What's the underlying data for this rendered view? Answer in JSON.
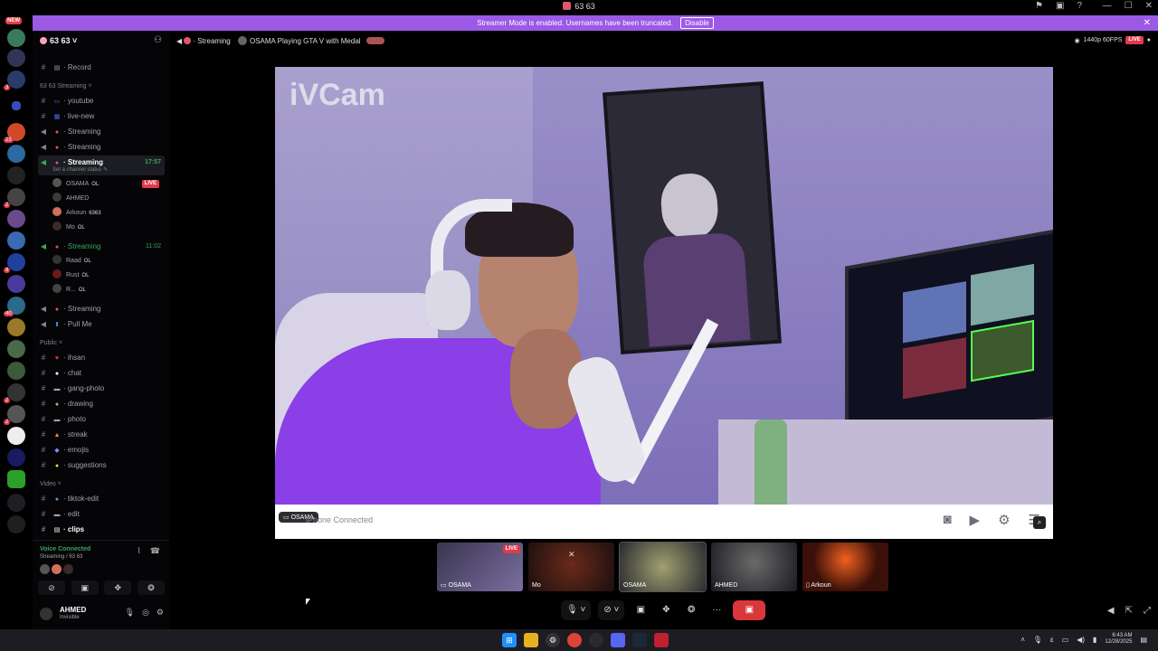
{
  "window": {
    "title": "63 63"
  },
  "banner": {
    "text": "Streamer Mode is enabled. Usernames have been truncated.",
    "disable_label": "Disable"
  },
  "guild_rail": {
    "new_badge": "NEW"
  },
  "sidebar": {
    "server_name": "63 63",
    "top_items": [
      "Record"
    ],
    "streaming_category": "63 63 Streaming",
    "channels": [
      {
        "label": "youtube"
      },
      {
        "label": "live-new"
      },
      {
        "label": "Streaming"
      },
      {
        "label": "Streaming"
      }
    ],
    "active_channel": {
      "label": "Streaming",
      "time": "17:57",
      "status": "Set a channel status"
    },
    "active_members": [
      {
        "name": "OSAMA",
        "tag": "OL",
        "live": "LIVE"
      },
      {
        "name": "AHMED",
        "tag": ""
      },
      {
        "name": "Arkoun",
        "tag": "6363"
      },
      {
        "name": "Mo",
        "tag": "OL"
      }
    ],
    "second_channel": {
      "label": "Streaming",
      "time": "11:02"
    },
    "second_members": [
      {
        "name": "Raad",
        "tag": "OL"
      },
      {
        "name": "Rust",
        "tag": "OL"
      },
      {
        "name": "R...",
        "tag": "OL"
      }
    ],
    "more_channels": [
      {
        "label": "Streaming"
      },
      {
        "label": "Pull Me"
      }
    ],
    "public_category": "Public",
    "public_channels": [
      {
        "label": "ihsan"
      },
      {
        "label": "chat"
      },
      {
        "label": "gang-photo"
      },
      {
        "label": "drawing"
      },
      {
        "label": "photo"
      },
      {
        "label": "streak"
      },
      {
        "label": "emojis"
      },
      {
        "label": "suggestions"
      }
    ],
    "video_category": "Video",
    "video_channels": [
      {
        "label": "tiktok-edit"
      },
      {
        "label": "edit"
      },
      {
        "label": "clips"
      }
    ]
  },
  "voice_panel": {
    "title": "Voice Connected",
    "subtitle": "Streaming / 63 63"
  },
  "user_panel": {
    "name": "AHMED",
    "status": "Invisible"
  },
  "stage": {
    "channel": "Streaming",
    "activity": "OSAMA Playing GTA V with Medal",
    "quality": "1440p 60FPS",
    "live": "LIVE"
  },
  "video": {
    "watermark": "iVCam",
    "status": "iPhone Connected",
    "name_chip": "OSAMA"
  },
  "tiles": [
    {
      "name": "OSAMA",
      "live": "LIVE"
    },
    {
      "name": "Mo"
    },
    {
      "name": "OSAMA"
    },
    {
      "name": "AHMED"
    },
    {
      "name": "Arkoun"
    }
  ],
  "taskbar": {
    "time": "6:43 AM",
    "date": "12/28/2025"
  }
}
